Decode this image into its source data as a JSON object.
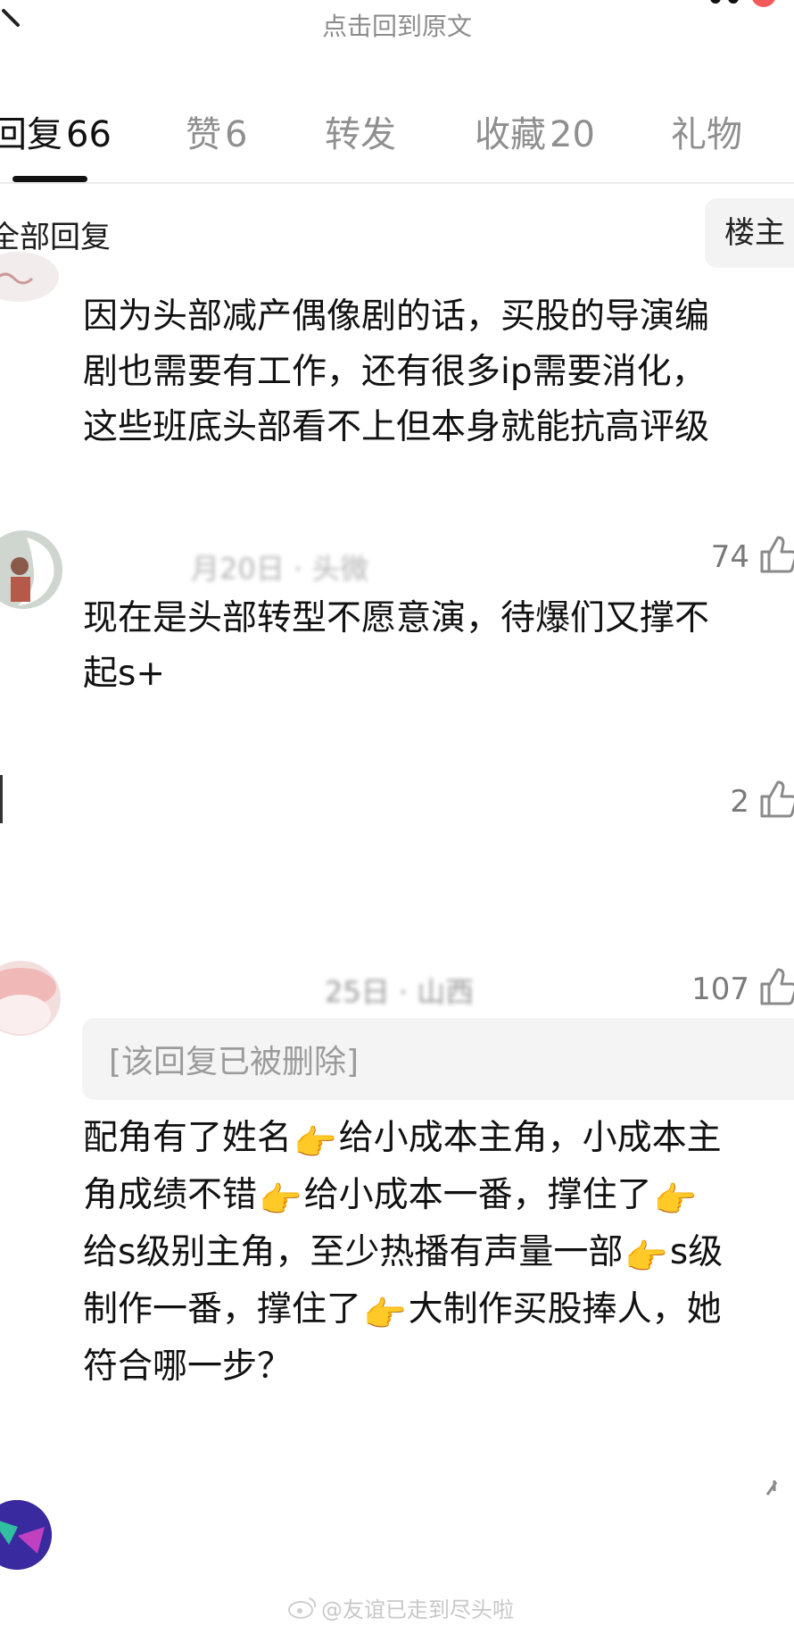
{
  "header": {
    "back_to_post": "点击回到原文"
  },
  "tabs": [
    {
      "label": "回复",
      "count": "66",
      "active": true
    },
    {
      "label": "赞",
      "count": "6",
      "active": false
    },
    {
      "label": "转发",
      "count": "",
      "active": false
    },
    {
      "label": "收藏",
      "count": "20",
      "active": false
    },
    {
      "label": "礼物",
      "count": "",
      "active": false
    }
  ],
  "filters": {
    "all_replies": "全部回复",
    "op_only": "楼主"
  },
  "comments": [
    {
      "lines": [
        "因为头部减产偶像剧的话，买股的导演编",
        "剧也需要有工作，还有很多ip需要消化，",
        "这些班底头部看不上但本身就能抗高评级"
      ]
    },
    {
      "meta": "月20日 · 头微",
      "likes": "74",
      "lines": [
        "现在是头部转型不愿意演，待爆们又撑不",
        "起s+"
      ]
    },
    {
      "likes": "2"
    },
    {
      "meta": "25日 · 山西",
      "likes": "107",
      "quoted": "[该回复已被删除]",
      "lines": [
        [
          "配角有了姓名",
          "👉",
          "给小成本主角，小成本主"
        ],
        [
          "角成绩不错",
          "👉",
          "给小成本一番，撑住了",
          "👉"
        ],
        [
          "给s级别主角，至少热播有声量一部",
          "👉",
          "s级"
        ],
        [
          "制作一番，撑住了",
          "👉",
          "大制作买股捧人，她"
        ],
        [
          "符合哪一步？"
        ]
      ]
    }
  ],
  "watermark": "@友谊已走到尽头啦",
  "colors": {
    "text": "#111111",
    "muted": "#9a9a9a",
    "tab_inactive": "#8f8f8f",
    "panel": "#f4f4f4"
  }
}
